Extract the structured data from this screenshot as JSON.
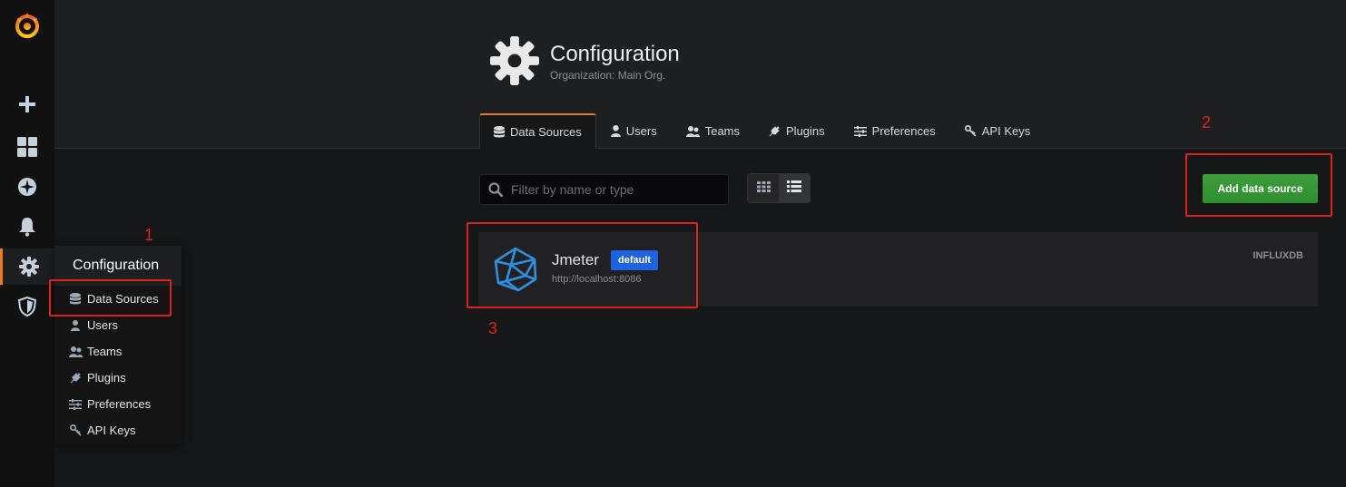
{
  "sidebar": {
    "icons": [
      "grafana-logo",
      "plus-icon",
      "dashboards-icon",
      "explore-icon",
      "bell-icon",
      "gear-icon",
      "shield-icon"
    ]
  },
  "flyout": {
    "title": "Configuration",
    "items": [
      {
        "label": "Data Sources",
        "icon": "database-icon"
      },
      {
        "label": "Users",
        "icon": "user-icon"
      },
      {
        "label": "Teams",
        "icon": "users-icon"
      },
      {
        "label": "Plugins",
        "icon": "plug-icon"
      },
      {
        "label": "Preferences",
        "icon": "sliders-icon"
      },
      {
        "label": "API Keys",
        "icon": "key-icon"
      }
    ]
  },
  "page": {
    "title": "Configuration",
    "subtitle": "Organization: Main Org."
  },
  "tabs": [
    {
      "label": "Data Sources",
      "icon": "database-icon",
      "active": true
    },
    {
      "label": "Users",
      "icon": "user-icon"
    },
    {
      "label": "Teams",
      "icon": "users-icon"
    },
    {
      "label": "Plugins",
      "icon": "plug-icon"
    },
    {
      "label": "Preferences",
      "icon": "sliders-icon"
    },
    {
      "label": "API Keys",
      "icon": "key-icon"
    }
  ],
  "toolbar": {
    "search_placeholder": "Filter by name or type",
    "add_button": "Add data source"
  },
  "datasource": {
    "name": "Jmeter",
    "badge": "default",
    "url": "http://localhost:8086",
    "type": "INFLUXDB"
  },
  "annotations": [
    "1",
    "2",
    "3"
  ],
  "colors": {
    "accent": "#eb7b18",
    "primary_btn": "#2f8e2d",
    "badge": "#1f62e0",
    "annotation": "#e02020"
  }
}
